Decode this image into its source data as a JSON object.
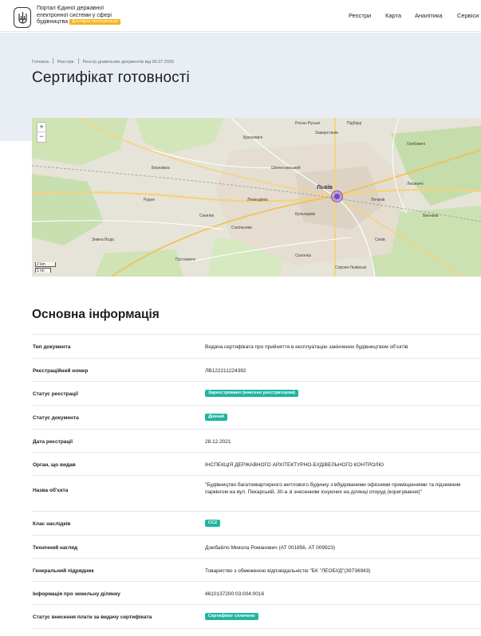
{
  "header": {
    "portal_line1": "Портал Єдиної державної",
    "portal_line2": "електронної системи у сфері",
    "portal_line3": "будівництва",
    "beta_label": "Дослідна експлуатація",
    "nav": [
      "Реєстри",
      "Карта",
      "Аналітика",
      "Сервіси"
    ]
  },
  "breadcrumb": [
    "Головна",
    "Реєстри",
    "Реєстр дозвільних документів від 06.07.2020"
  ],
  "page_title": "Сертифікат готовності",
  "map": {
    "zoom_in": "+",
    "zoom_out": "−",
    "scale_km": "2 km",
    "scale_mi": "1 mi",
    "labels": {
      "city": "Львів",
      "l1": "Рясне-Руське",
      "l2": "Замарстинів",
      "l3": "Підбірці",
      "l4": "Брюховичі",
      "l5": "Грибовичі",
      "l6": "Зимна Вода",
      "l7": "Сихів",
      "l8": "Винники",
      "l9": "Шевченківський",
      "l10": "Личаків",
      "l11": "Солонка",
      "l12": "Пустомити",
      "l13": "Рудне",
      "l14": "Левандівка",
      "l15": "Сокільники",
      "l16": "Березівка",
      "l17": "Лисиничі",
      "l18": "Кульпарків",
      "l19": "Скнилів",
      "l20": "Сороки-Львівські"
    }
  },
  "section_title": "Основна інформація",
  "rows": [
    {
      "key": "Тип документа",
      "value": "Видача сертифіката про прийняття в експлуатацію закінчених будівництвом об’єктів"
    },
    {
      "key": "Реєстраційний номер",
      "value": "ЛВ122211224392"
    },
    {
      "key": "Статус реєстрації",
      "badge": "Зареєстровано (внесено реєстратором)"
    },
    {
      "key": "Статус документа",
      "badge": "Діючий"
    },
    {
      "key": "Дата реєстрації",
      "value": "28.12.2021"
    },
    {
      "key": "Орган, що видав",
      "value": "ІНСПЕКЦІЯ ДЕРЖАВНОГО АРХІТЕКТУРНО-БУДІВЕЛЬНОГО КОНТРОЛЮ"
    },
    {
      "key": "Назва об’єкта",
      "value": "\"Будівництво багатоквартирного житлового будинку з вбудованими офісними приміщеннями та підземним паркінгом на вул. Пекарській, 30-а зі знесенням існуючих на ділянці споруд (коригування)\""
    },
    {
      "key": "Клас наслідків",
      "badge": "СС2"
    },
    {
      "key": "Технічний нагляд",
      "value": "Дзюбайло Микола Романович (АТ 001856, АТ 009923)"
    },
    {
      "key": "Генеральний підрядник",
      "value": "Товариство з обмеженою відповідальністю \"БК \"ЛЕОБУД\"(39736943)"
    },
    {
      "key": "Інформація про земельну ділянку",
      "value": "4610137200:03:004:0016"
    },
    {
      "key": "Статус внесення плати за видачу сертифіката",
      "badge": "Сертифікат сплачено"
    }
  ],
  "colors": {
    "badge": "#1fb5a0",
    "beta": "#f4b41a",
    "hero": "#e8eef4",
    "marker": "#6f46d8"
  }
}
